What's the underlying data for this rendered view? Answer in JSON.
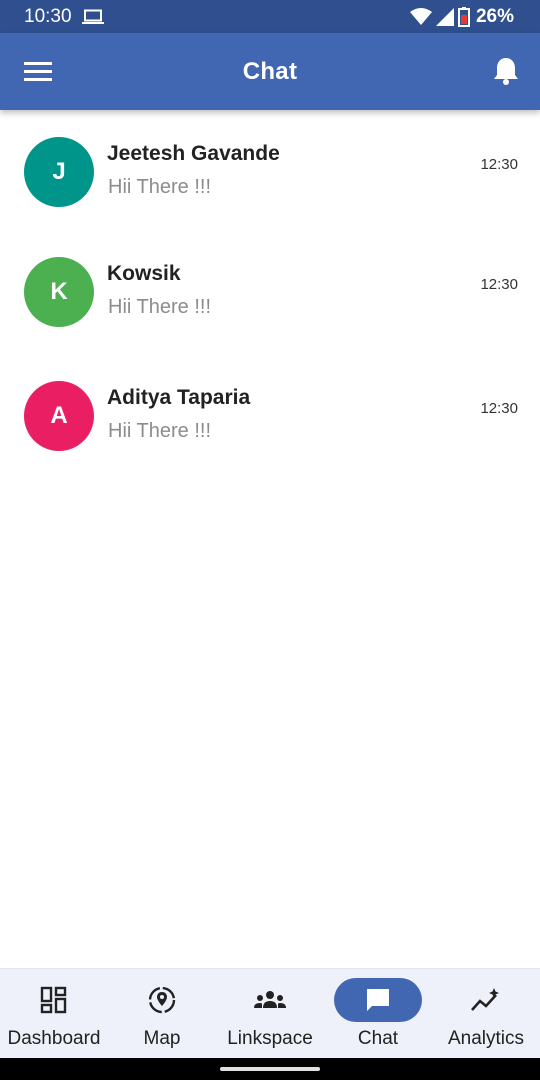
{
  "status_bar": {
    "time": "10:30",
    "battery": "26%",
    "icons": [
      "laptop-icon",
      "wifi-icon",
      "signal-icon",
      "battery-icon"
    ]
  },
  "app_bar": {
    "title": "Chat",
    "left_icon": "menu-icon",
    "right_icon": "bell-icon",
    "color": "#4267b2"
  },
  "chats": [
    {
      "initial": "J",
      "name": "Jeetesh Gavande",
      "message": "Hii There !!!",
      "time": "12:30",
      "color": "#00958a"
    },
    {
      "initial": "K",
      "name": "Kowsik",
      "message": "Hii There !!!",
      "time": "12:30",
      "color": "#4caf50"
    },
    {
      "initial": "A",
      "name": "Aditya Taparia",
      "message": "Hii There !!!",
      "time": "12:30",
      "color": "#e91e63"
    }
  ],
  "bottom_nav": {
    "items": [
      {
        "label": "Dashboard",
        "icon": "dashboard-icon",
        "active": false
      },
      {
        "label": "Map",
        "icon": "map-pin-icon",
        "active": false
      },
      {
        "label": "Linkspace",
        "icon": "group-icon",
        "active": false
      },
      {
        "label": "Chat",
        "icon": "chat-icon",
        "active": true
      },
      {
        "label": "Analytics",
        "icon": "analytics-icon",
        "active": false
      }
    ]
  }
}
